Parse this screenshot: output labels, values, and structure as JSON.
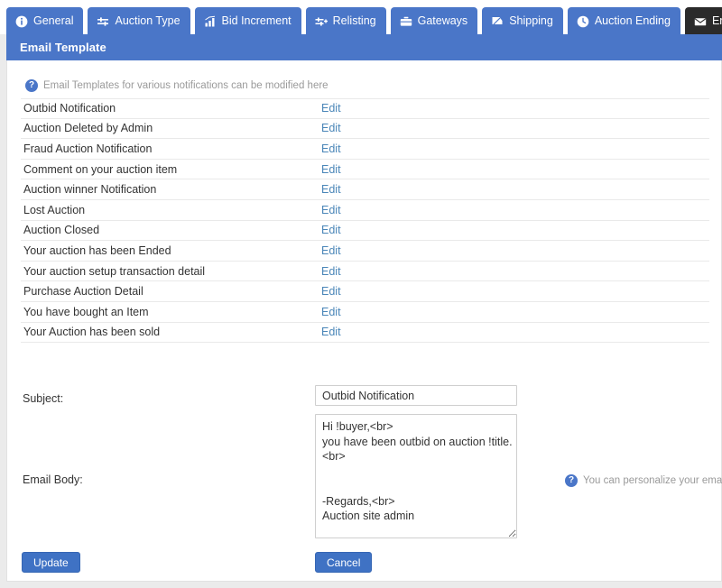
{
  "tabs": [
    {
      "label": "General",
      "icon": "info-icon",
      "active": false
    },
    {
      "label": "Auction Type",
      "icon": "sliders-icon",
      "active": false
    },
    {
      "label": "Bid Increment",
      "icon": "bar-chart-icon",
      "active": false
    },
    {
      "label": "Relisting",
      "icon": "sliders-plus-icon",
      "active": false
    },
    {
      "label": "Gateways",
      "icon": "briefcase-icon",
      "active": false
    },
    {
      "label": "Shipping",
      "icon": "truck-icon",
      "active": false
    },
    {
      "label": "Auction Ending",
      "icon": "clock-icon",
      "active": false
    },
    {
      "label": "Email Template",
      "icon": "envelope-icon",
      "active": true
    }
  ],
  "section": {
    "title": "Email Template"
  },
  "hints": {
    "top": "Email Templates for various notifications can be modified here",
    "body": "You can personalize your emails using th",
    "icon": "question-mark-icon"
  },
  "templates": {
    "edit_label": "Edit",
    "rows": [
      {
        "name": "Outbid Notification"
      },
      {
        "name": "Auction Deleted by Admin"
      },
      {
        "name": "Fraud Auction Notification"
      },
      {
        "name": "Comment on your auction item"
      },
      {
        "name": "Auction winner Notification"
      },
      {
        "name": "Lost Auction"
      },
      {
        "name": "Auction Closed"
      },
      {
        "name": "Your auction has been Ended"
      },
      {
        "name": "Your auction setup transaction detail"
      },
      {
        "name": "Purchase Auction Detail"
      },
      {
        "name": "You have bought an Item"
      },
      {
        "name": "Your Auction has been sold"
      }
    ]
  },
  "form": {
    "subject_label": "Subject:",
    "subject_value": "Outbid Notification",
    "body_label": "Email Body:",
    "body_value": "Hi !buyer,<br>\nyou have been outbid on auction !title.\n<br>\n\n\n-Regards,<br>\nAuction site admin",
    "update_label": "Update",
    "cancel_label": "Cancel"
  },
  "colors": {
    "tab_blue": "#4a76c8",
    "tab_active": "#2b2b2b",
    "link_blue": "#4a86b8",
    "button_blue": "#3f72c4",
    "hint_gray": "#9a9a9a"
  }
}
